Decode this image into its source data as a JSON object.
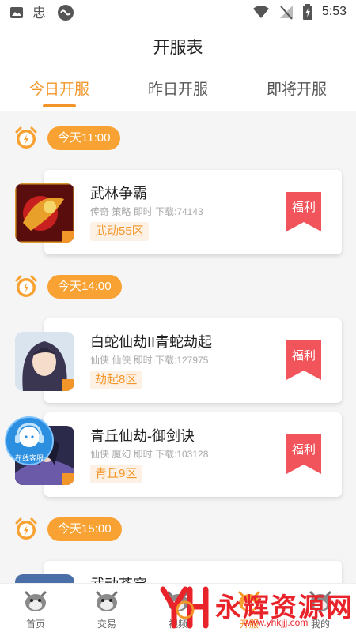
{
  "status_bar": {
    "time": "5:53"
  },
  "header": {
    "title": "开服表"
  },
  "tabs": [
    {
      "label": "今日开服",
      "active": true
    },
    {
      "label": "昨日开服",
      "active": false
    },
    {
      "label": "即将开服",
      "active": false
    }
  ],
  "slots": [
    {
      "time": "今天11:00",
      "games": [
        {
          "name": "武林争霸",
          "meta": "传奇 策略 即时 下载:74143",
          "server": "武动55区",
          "badge": "福利"
        }
      ]
    },
    {
      "time": "今天14:00",
      "games": [
        {
          "name": "白蛇仙劫II青蛇劫起",
          "meta": "仙侠 仙侠 即时 下载:127975",
          "server": "劫起8区",
          "badge": "福利"
        },
        {
          "name": "青丘仙劫-御剑诀",
          "meta": "仙侠 魔幻 即时 下载:103128",
          "server": "青丘9区",
          "badge": "福利"
        }
      ]
    },
    {
      "time": "今天15:00",
      "games": [
        {
          "name": "武动苍穹",
          "meta": "",
          "server": "",
          "badge": ""
        }
      ]
    }
  ],
  "customer_service": {
    "label": "在线客服"
  },
  "bottom_nav": [
    {
      "label": "首页",
      "icon": "home-mascot-icon",
      "active": false
    },
    {
      "label": "交易",
      "icon": "trade-mascot-icon",
      "active": false
    },
    {
      "label": "视频",
      "icon": "video-mascot-icon",
      "active": false
    },
    {
      "label": "开服",
      "icon": "server-mascot-icon",
      "active": true
    },
    {
      "label": "我的",
      "icon": "profile-mascot-icon",
      "active": false
    }
  ],
  "watermark": {
    "text": "永辉资源网",
    "url": "www.yhkjjj.com"
  },
  "colors": {
    "accent": "#f39629",
    "ribbon": "#f2545b",
    "server_bg": "#fdf0e4",
    "cs_blue": "#2d8fe0"
  }
}
